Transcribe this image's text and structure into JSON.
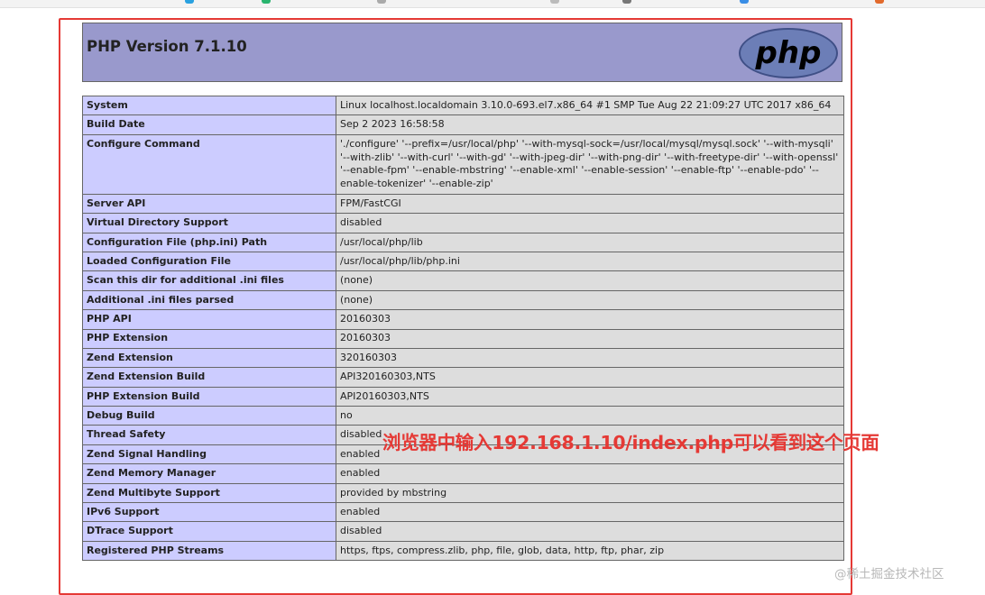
{
  "page": {
    "title": "PHP Version 7.1.10",
    "logo_text": "php"
  },
  "info_rows": [
    {
      "label": "System",
      "value": "Linux localhost.localdomain 3.10.0-693.el7.x86_64 #1 SMP Tue Aug 22 21:09:27 UTC 2017 x86_64"
    },
    {
      "label": "Build Date",
      "value": "Sep 2 2023 16:58:58"
    },
    {
      "label": "Configure Command",
      "value": "'./configure' '--prefix=/usr/local/php' '--with-mysql-sock=/usr/local/mysql/mysql.sock' '--with-mysqli' '--with-zlib' '--with-curl' '--with-gd' '--with-jpeg-dir' '--with-png-dir' '--with-freetype-dir' '--with-openssl' '--enable-fpm' '--enable-mbstring' '--enable-xml' '--enable-session' '--enable-ftp' '--enable-pdo' '--enable-tokenizer' '--enable-zip'"
    },
    {
      "label": "Server API",
      "value": "FPM/FastCGI"
    },
    {
      "label": "Virtual Directory Support",
      "value": "disabled"
    },
    {
      "label": "Configuration File (php.ini) Path",
      "value": "/usr/local/php/lib"
    },
    {
      "label": "Loaded Configuration File",
      "value": "/usr/local/php/lib/php.ini"
    },
    {
      "label": "Scan this dir for additional .ini files",
      "value": "(none)"
    },
    {
      "label": "Additional .ini files parsed",
      "value": "(none)"
    },
    {
      "label": "PHP API",
      "value": "20160303"
    },
    {
      "label": "PHP Extension",
      "value": "20160303"
    },
    {
      "label": "Zend Extension",
      "value": "320160303"
    },
    {
      "label": "Zend Extension Build",
      "value": "API320160303,NTS"
    },
    {
      "label": "PHP Extension Build",
      "value": "API20160303,NTS"
    },
    {
      "label": "Debug Build",
      "value": "no"
    },
    {
      "label": "Thread Safety",
      "value": "disabled"
    },
    {
      "label": "Zend Signal Handling",
      "value": "enabled"
    },
    {
      "label": "Zend Memory Manager",
      "value": "enabled"
    },
    {
      "label": "Zend Multibyte Support",
      "value": "provided by mbstring"
    },
    {
      "label": "IPv6 Support",
      "value": "enabled"
    },
    {
      "label": "DTrace Support",
      "value": "disabled"
    },
    {
      "label": "Registered PHP Streams",
      "value": "https, ftps, compress.zlib, php, file, glob, data, http, ftp, phar, zip"
    }
  ],
  "annotation": "浏览器中输入192.168.1.10/index.php可以看到这个页面",
  "watermark": "@稀土掘金技术社区",
  "colors": {
    "header_bg": "#9999cc",
    "label_bg": "#ccccff",
    "value_bg": "#dddddd",
    "highlight": "#e53935",
    "logo_bg": "#6c7eb7"
  }
}
